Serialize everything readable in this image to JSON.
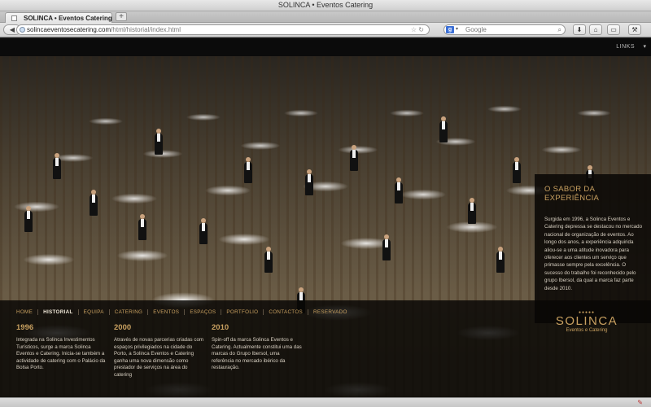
{
  "window": {
    "title": "SOLINCA • Eventos Catering"
  },
  "tabs": [
    {
      "label": "SOLINCA • Eventos Catering"
    }
  ],
  "toolbar": {
    "new_tab_label": "+",
    "url_domain": "solincaeventosecatering.com",
    "url_rest": "/html/historial/index.html",
    "search_placeholder": "Google",
    "search_engine_icon": "google-icon",
    "icons": [
      "back-icon",
      "forward-icon",
      "globe-icon",
      "bookmark-star-icon",
      "reload-icon",
      "download-icon",
      "home-icon",
      "window-icon",
      "tools-icon"
    ]
  },
  "site": {
    "links_label": "LINKS",
    "info": {
      "title_line1": "O SABOR DA",
      "title_line2": "EXPERIÊNCIA",
      "text": "Surgida em 1996, a Solinca Eventos e Catering depressa se destacou no mercado nacional de organização de eventos. Ao longo dos anos, a experiência adquirida aliou-se a uma atitude inovadora para oferecer aos clientes um serviço que primasse sempre pela excelência. O sucesso do trabalho foi reconhecido pelo grupo Ibersol, da qual a marca faz parte desde 2010."
    },
    "nav": [
      {
        "label": "HOME"
      },
      {
        "label": "HISTORIAL"
      },
      {
        "label": "EQUIPA"
      },
      {
        "label": "CATERING"
      },
      {
        "label": "EVENTOS"
      },
      {
        "label": "ESPAÇOS"
      },
      {
        "label": "PORTFOLIO"
      },
      {
        "label": "CONTACTOS"
      },
      {
        "label": "RESERVADO"
      }
    ],
    "nav_active": "HISTORIAL",
    "history": [
      {
        "year": "1996",
        "text": "Integrada na Solinca Investimentos Turísticos, surge a marca Solinca Eventos e Catering. Inicia-se também a actividade de catering com o Palácio da Bolsa Porto."
      },
      {
        "year": "2000",
        "text": "Através de novas parcerias criadas com espaços privilegiados na cidade do Porto, a Solinca Eventos e Catering ganha uma nova dimensão como prestador de serviços na área do catering"
      },
      {
        "year": "2010",
        "text": "Spin-off da marca Solinca Eventos e Catering. Actualmente constitui uma das marcas do Grupo Ibersol, uma referência no mercado ibérico da restauração."
      }
    ],
    "logo": {
      "dots": "●●●●●",
      "name": "SOLINCA",
      "sub": "Eventos e Catering"
    },
    "colors": {
      "accent": "#c8a060",
      "panel": "#0a0806"
    }
  }
}
